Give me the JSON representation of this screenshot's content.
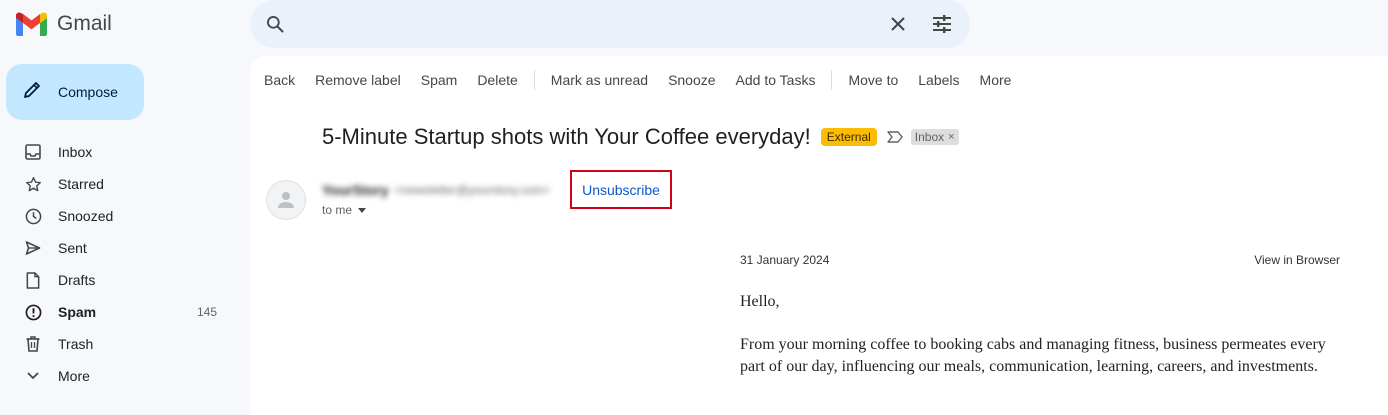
{
  "app": {
    "name": "Gmail"
  },
  "search": {
    "placeholder": "",
    "value": ""
  },
  "compose": {
    "label": "Compose"
  },
  "sidebar": {
    "items": [
      {
        "label": "Inbox",
        "icon": "inbox-icon"
      },
      {
        "label": "Starred",
        "icon": "star-icon"
      },
      {
        "label": "Snoozed",
        "icon": "clock-icon"
      },
      {
        "label": "Sent",
        "icon": "send-icon"
      },
      {
        "label": "Drafts",
        "icon": "file-icon"
      },
      {
        "label": "Spam",
        "icon": "report-icon",
        "count": "145"
      },
      {
        "label": "Trash",
        "icon": "trash-icon"
      },
      {
        "label": "More",
        "icon": "chevron-down-icon"
      }
    ]
  },
  "toolbar": {
    "back": "Back",
    "remove_label": "Remove label",
    "spam": "Spam",
    "delete": "Delete",
    "mark_unread": "Mark as unread",
    "snooze": "Snooze",
    "add_tasks": "Add to Tasks",
    "move_to": "Move to",
    "labels": "Labels",
    "more": "More"
  },
  "email": {
    "subject": "5-Minute Startup shots with Your Coffee everyday!",
    "external_badge": "External",
    "label_chip": "Inbox",
    "label_remove": "×",
    "sender_name": "YourStory",
    "sender_email": "<newsletter@yourstory.com>",
    "unsubscribe": "Unsubscribe",
    "to": "to me",
    "date": "31 January 2024",
    "view_in_browser": "View in Browser",
    "greeting": "Hello,",
    "body": "From your morning coffee to booking cabs and managing fitness, business permeates every part of our day, influencing our meals, communication, learning, careers, and investments."
  },
  "colors": {
    "accent": "#0b57d0",
    "compose_bg": "#c2e7ff",
    "external_badge": "#fbbc04",
    "highlight_box": "#d0021b",
    "search_bg": "#eaf1fb"
  }
}
